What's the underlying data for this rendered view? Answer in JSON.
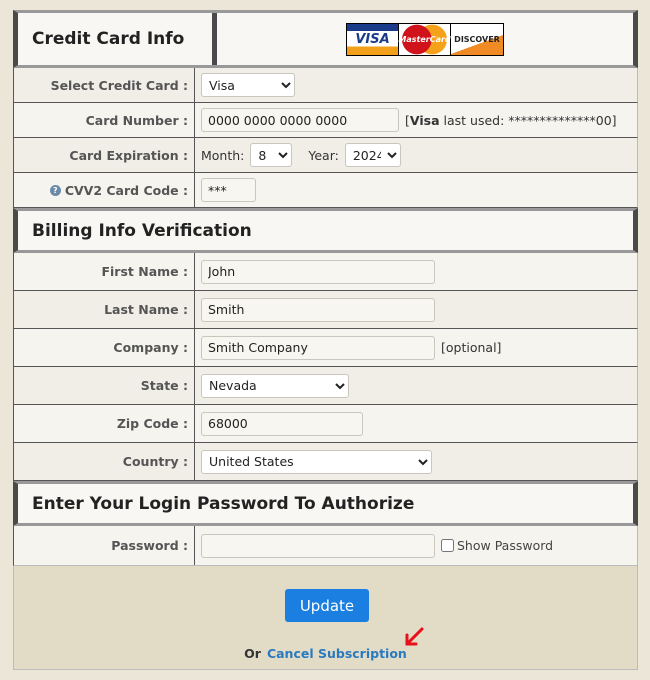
{
  "credit": {
    "title": "Credit Card Info",
    "card_logos": [
      "VISA",
      "MasterCard",
      "DISCOVER"
    ],
    "select_label": "Select Credit Card :",
    "select_value": "Visa",
    "number_label": "Card Number :",
    "number_value": "0000 0000 0000 0000",
    "last_used_brand": "Visa",
    "last_used_text": "last used: **************00]",
    "last_used_open": "[",
    "exp_label": "Card Expiration :",
    "month_label": "Month:",
    "month_value": "8",
    "year_label": "Year:",
    "year_value": "2024",
    "cvv_label": "CVV2 Card Code :",
    "cvv_value": "***"
  },
  "billing": {
    "title": "Billing Info Verification",
    "first_label": "First Name :",
    "first_value": "John",
    "last_label": "Last Name :",
    "last_value": "Smith",
    "company_label": "Company :",
    "company_value": "Smith Company",
    "company_note": "[optional]",
    "state_label": "State :",
    "state_value": "Nevada",
    "zip_label": "Zip Code :",
    "zip_value": "68000",
    "country_label": "Country :",
    "country_value": "United States"
  },
  "auth": {
    "title": "Enter Your Login Password To Authorize",
    "password_label": "Password :",
    "password_value": "",
    "show_password": "Show Password",
    "show_checked": false
  },
  "footer": {
    "update": "Update",
    "or": "Or",
    "cancel": "Cancel Subscription"
  },
  "colors": {
    "accent": "#1a7fe0",
    "link": "#2a7ac0",
    "arrow": "#e8101a"
  }
}
